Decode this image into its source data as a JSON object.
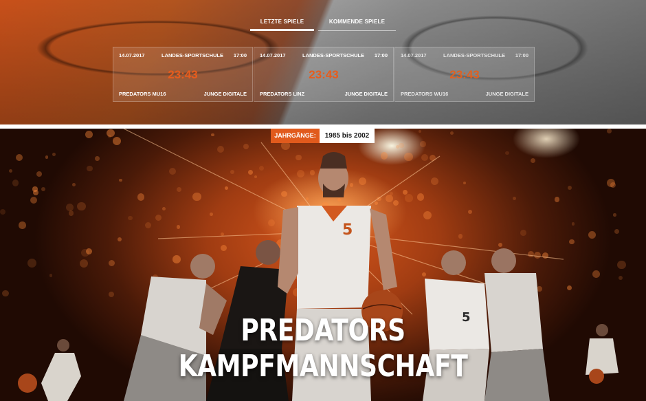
{
  "tabs": [
    {
      "label": "LETZTE SPIELE",
      "active": true
    },
    {
      "label": "KOMMENDE SPIELE",
      "active": false
    }
  ],
  "games": [
    {
      "date": "14.07.2017",
      "venue": "LANDES-SPORTSCHULE",
      "time": "17:00",
      "score": "23:43",
      "home": "PREDATORS MU16",
      "away": "JUNGE DIGITALE"
    },
    {
      "date": "14.07.2017",
      "venue": "LANDES-SPORTSCHULE",
      "time": "17:00",
      "score": "23:43",
      "home": "PREDATORS LINZ",
      "away": "JUNGE DIGITALE"
    },
    {
      "date": "14.07.2017",
      "venue": "LANDES-SPORTSCHULE",
      "time": "17:00",
      "score": "23:43",
      "home": "PREDATORS WU16",
      "away": "JUNGE DIGITALE"
    }
  ],
  "hero": {
    "years_label": "JAHRGÄNGE:",
    "years_value": "1985 bis 2002",
    "title_line1": "PREDATORS",
    "title_line2": "KAMPFMANNSCHAFT"
  },
  "colors": {
    "accent": "#e15a1c",
    "score": "#e85c1c"
  }
}
